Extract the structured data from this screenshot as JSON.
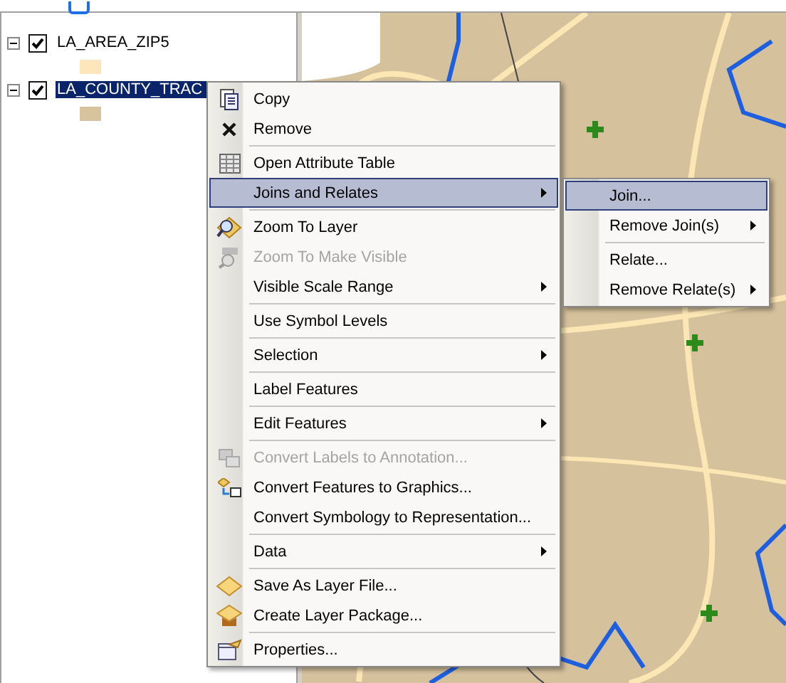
{
  "layers": [
    {
      "name": "LA_AREA_ZIP5",
      "checked": true,
      "expanded": true,
      "selected": false,
      "color": "#fde6bc"
    },
    {
      "name": "LA_COUNTY_TRAC",
      "checked": true,
      "expanded": true,
      "selected": true,
      "color": "#d7c39e"
    }
  ],
  "context_menu": {
    "items": [
      {
        "kind": "item",
        "label": "Copy",
        "disabled": false,
        "selected": false,
        "has_submenu": false
      },
      {
        "kind": "item",
        "label": "Remove",
        "disabled": false,
        "selected": false,
        "has_submenu": false
      },
      {
        "kind": "separator"
      },
      {
        "kind": "item",
        "label": "Open Attribute Table",
        "disabled": false,
        "selected": false,
        "has_submenu": false
      },
      {
        "kind": "item",
        "label": "Joins and Relates",
        "disabled": false,
        "selected": true,
        "has_submenu": true
      },
      {
        "kind": "separator"
      },
      {
        "kind": "item",
        "label": "Zoom To Layer",
        "disabled": false,
        "selected": false,
        "has_submenu": false
      },
      {
        "kind": "item",
        "label": "Zoom To Make Visible",
        "disabled": true,
        "selected": false,
        "has_submenu": false
      },
      {
        "kind": "item",
        "label": "Visible Scale Range",
        "disabled": false,
        "selected": false,
        "has_submenu": true
      },
      {
        "kind": "separator"
      },
      {
        "kind": "item",
        "label": "Use Symbol Levels",
        "disabled": false,
        "selected": false,
        "has_submenu": false
      },
      {
        "kind": "separator"
      },
      {
        "kind": "item",
        "label": "Selection",
        "disabled": false,
        "selected": false,
        "has_submenu": true
      },
      {
        "kind": "separator"
      },
      {
        "kind": "item",
        "label": "Label Features",
        "disabled": false,
        "selected": false,
        "has_submenu": false
      },
      {
        "kind": "separator"
      },
      {
        "kind": "item",
        "label": "Edit Features",
        "disabled": false,
        "selected": false,
        "has_submenu": true
      },
      {
        "kind": "separator"
      },
      {
        "kind": "item",
        "label": "Convert Labels to Annotation...",
        "disabled": true,
        "selected": false,
        "has_submenu": false
      },
      {
        "kind": "item",
        "label": "Convert Features to Graphics...",
        "disabled": false,
        "selected": false,
        "has_submenu": false
      },
      {
        "kind": "item",
        "label": "Convert Symbology to Representation...",
        "disabled": false,
        "selected": false,
        "has_submenu": false
      },
      {
        "kind": "separator"
      },
      {
        "kind": "item",
        "label": "Data",
        "disabled": false,
        "selected": false,
        "has_submenu": true
      },
      {
        "kind": "separator"
      },
      {
        "kind": "item",
        "label": "Save As Layer File...",
        "disabled": false,
        "selected": false,
        "has_submenu": false
      },
      {
        "kind": "item",
        "label": "Create Layer Package...",
        "disabled": false,
        "selected": false,
        "has_submenu": false
      },
      {
        "kind": "separator"
      },
      {
        "kind": "item",
        "label": "Properties...",
        "disabled": false,
        "selected": false,
        "has_submenu": false
      }
    ]
  },
  "submenu": {
    "items": [
      {
        "kind": "item",
        "label": "Join...",
        "disabled": false,
        "selected": true,
        "has_submenu": false
      },
      {
        "kind": "item",
        "label": "Remove Join(s)",
        "disabled": false,
        "selected": false,
        "has_submenu": true
      },
      {
        "kind": "separator"
      },
      {
        "kind": "item",
        "label": "Relate...",
        "disabled": false,
        "selected": false,
        "has_submenu": false
      },
      {
        "kind": "item",
        "label": "Remove Relate(s)",
        "disabled": false,
        "selected": false,
        "has_submenu": true
      }
    ]
  }
}
